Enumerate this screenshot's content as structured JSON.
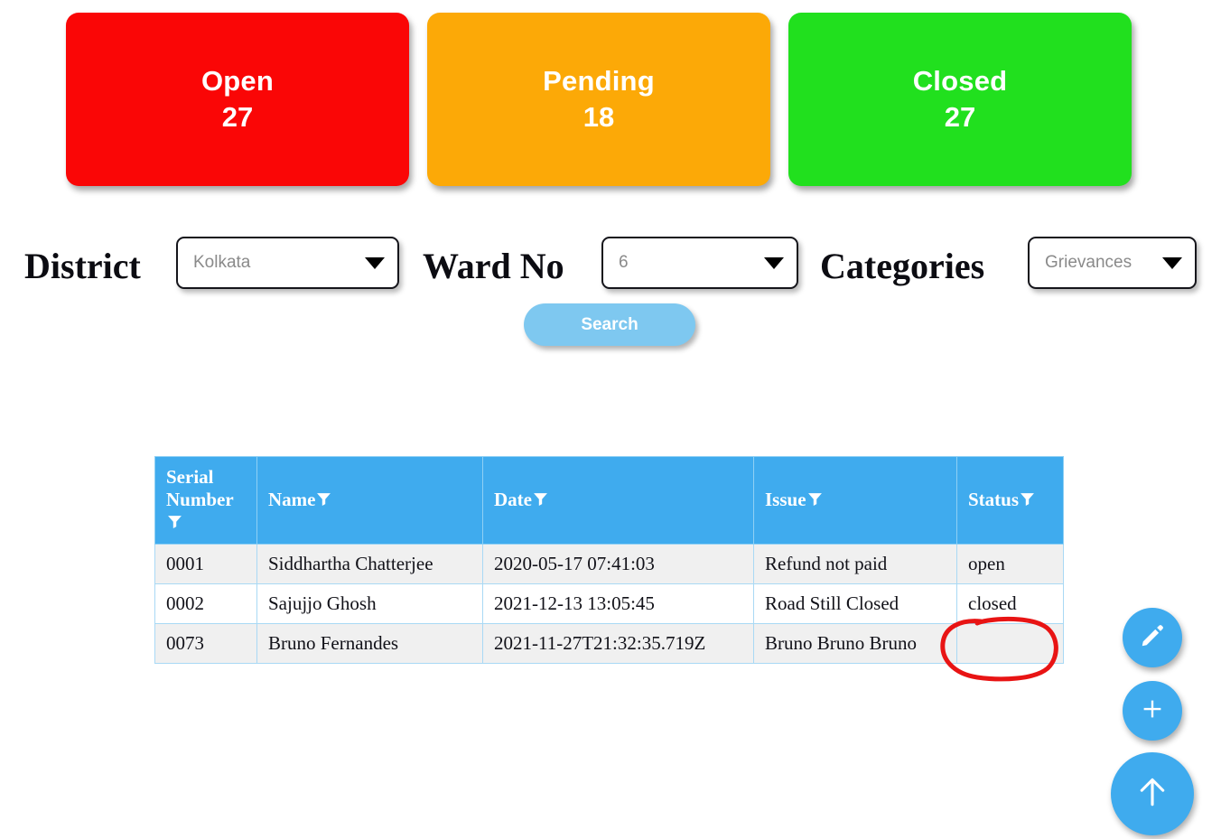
{
  "summary_cards": [
    {
      "label": "Open",
      "value": "27",
      "color": "#fa0606"
    },
    {
      "label": "Pending",
      "value": "18",
      "color": "#fca907"
    },
    {
      "label": "Closed",
      "value": "27",
      "color": "#21e01e"
    }
  ],
  "filters": {
    "district": {
      "label": "District",
      "value": "Kolkata"
    },
    "ward": {
      "label": "Ward No",
      "value": "6"
    },
    "category": {
      "label": "Categories",
      "value": "Grievances"
    },
    "search_button": "Search"
  },
  "table": {
    "columns": [
      {
        "key": "serial",
        "label": "Serial Number"
      },
      {
        "key": "name",
        "label": "Name"
      },
      {
        "key": "date",
        "label": "Date"
      },
      {
        "key": "issue",
        "label": "Issue"
      },
      {
        "key": "status",
        "label": "Status"
      }
    ],
    "rows": [
      {
        "serial": "0001",
        "name": "Siddhartha Chatterjee",
        "date": "2020-05-17 07:41:03",
        "issue": "Refund not paid",
        "status": "open"
      },
      {
        "serial": "0002",
        "name": "Sajujjo Ghosh",
        "date": "2021-12-13 13:05:45",
        "issue": "Road Still Closed",
        "status": "closed"
      },
      {
        "serial": "0073",
        "name": "Bruno Fernandes",
        "date": "2021-11-27T21:32:35.719Z",
        "issue": "Bruno Bruno Bruno",
        "status": ""
      }
    ]
  },
  "fab": {
    "edit_icon": "pencil-icon",
    "add_icon": "plus-icon",
    "scroll_top_icon": "arrow-up-icon"
  },
  "annotation": {
    "shape": "ellipse",
    "color": "#e81414",
    "targets": "empty-status-cell-row-0073"
  },
  "colors": {
    "table_header": "#3fabee",
    "search_button": "#7ec8f0",
    "fab": "#3fabee",
    "row_alt": "#f0f0f0"
  }
}
